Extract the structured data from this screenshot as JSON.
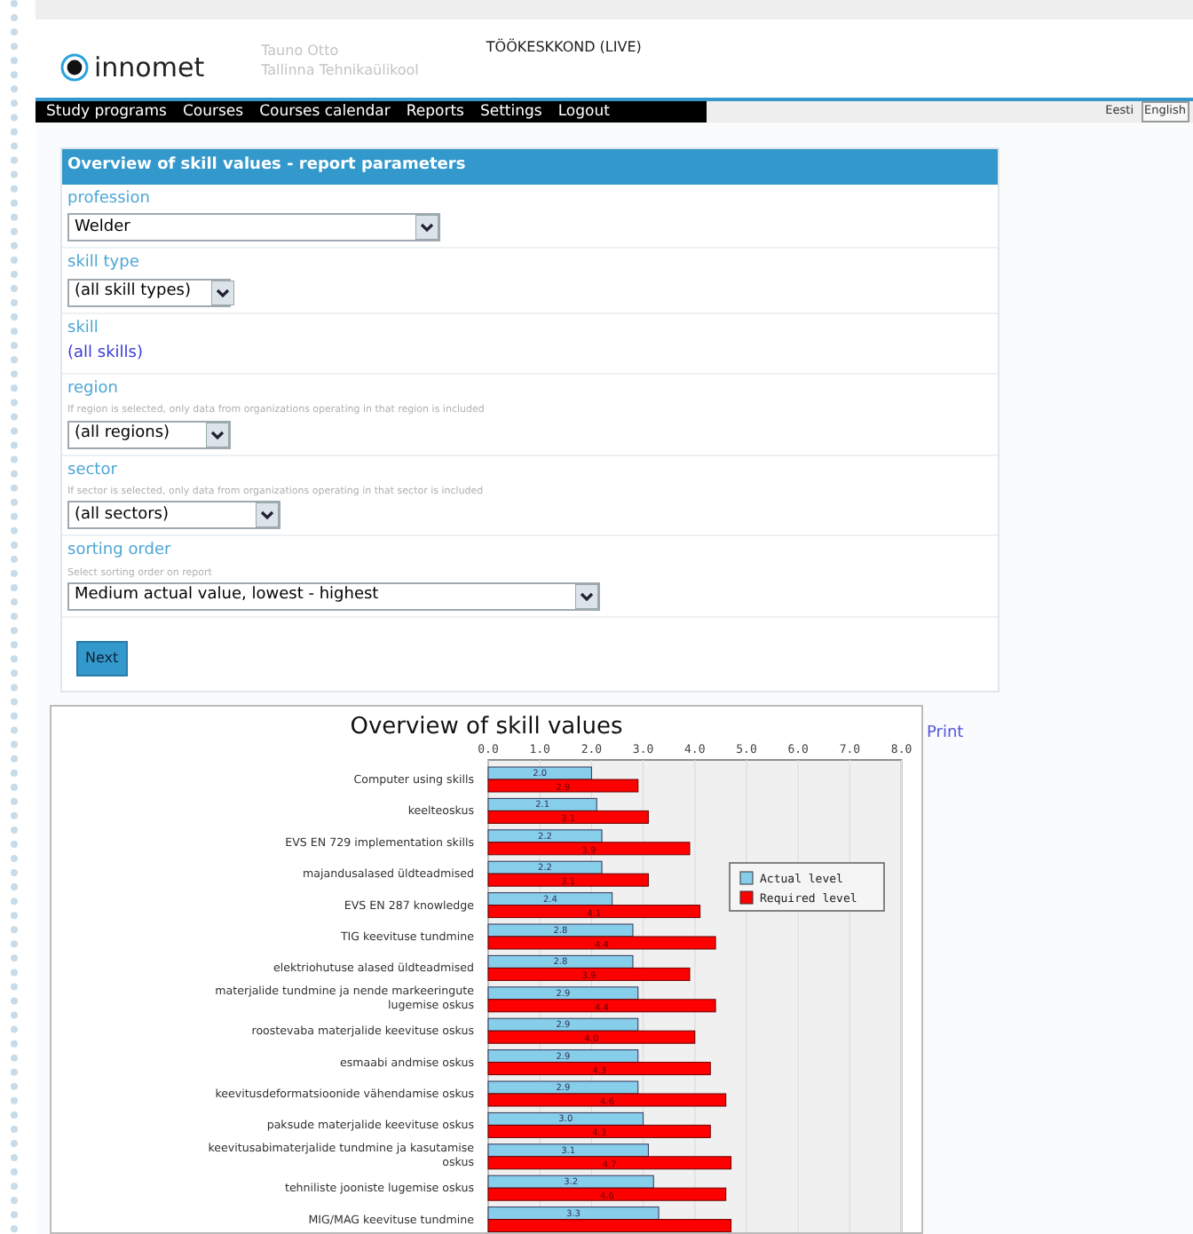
{
  "header": {
    "logo": "innomet",
    "user_name": "Tauno Otto",
    "organization": "Tallinna Tehnikaülikool",
    "environment": "TÖÖKESKKOND (LIVE)"
  },
  "nav": {
    "items": [
      "Study programs",
      "Courses",
      "Courses calendar",
      "Reports",
      "Settings",
      "Logout"
    ],
    "languages": [
      {
        "label": "Eesti",
        "selected": false
      },
      {
        "label": "English",
        "selected": true
      }
    ]
  },
  "form": {
    "title": "Overview of skill values - report parameters",
    "fields": [
      {
        "kind": "select",
        "label": "profession",
        "value": "Welder"
      },
      {
        "kind": "select",
        "label": "skill type",
        "value": "(all skill types)"
      },
      {
        "kind": "link",
        "label": "skill",
        "value": "(all skills)"
      },
      {
        "kind": "select",
        "label": "region",
        "hint": "If region is selected, only data from organizations operating in that region is included",
        "value": "(all regions)"
      },
      {
        "kind": "select",
        "label": "sector",
        "hint": "If sector is selected, only data from organizations operating in that sector is included",
        "value": "(all sectors)"
      },
      {
        "kind": "select",
        "label": "sorting order",
        "hint": "Select sorting order on report",
        "value": "Medium actual value, lowest - highest"
      }
    ],
    "button": "Next"
  },
  "report": {
    "print": "Print",
    "chart_data": {
      "type": "bar",
      "orientation": "horizontal",
      "title": "Overview of skill values",
      "grid": true,
      "legend": true,
      "value_labels": [
        [
          "2.0",
          "2.1",
          "2.2",
          "2.2",
          "2.4",
          "2.8",
          "2.8",
          "2.9",
          "2.9",
          "2.9",
          "2.9",
          "3.0",
          "3.1",
          "3.2",
          "3.3"
        ],
        [
          "2.9",
          "3.1",
          "3.9",
          "3.1",
          "4.1",
          "4.4",
          "3.9",
          "4.4",
          "4.0",
          "4.3",
          "4.6",
          "4.3",
          "4.7",
          "4.6",
          null
        ]
      ],
      "categories": [
        "Computer using skills",
        "keelteoskus",
        "EVS EN 729 implementation skills",
        "majandusalased üldteadmised",
        "EVS EN 287 knowledge",
        "TIG keevituse tundmine",
        "elektriohutuse alased üldteadmised",
        "materjalide tundmine ja nende markeeringute lugemise oskus",
        "roostevaba materjalide keevituse oskus",
        "esmaabi andmise oskus",
        "keevitusdeformatsioonide vähendamise oskus",
        "paksude materjalide keevituse oskus",
        "keevitusabimaterjalide tundmine ja kasutamise oskus",
        "tehniliste jooniste lugemise oskus",
        "MIG/MAG keevituse tundmine"
      ],
      "series": [
        {
          "name": "Actual level",
          "color": "#87ceeb",
          "values": [
            2.0,
            2.1,
            2.2,
            2.2,
            2.4,
            2.8,
            2.8,
            2.9,
            2.9,
            2.9,
            2.9,
            3.0,
            3.1,
            3.2,
            3.3
          ]
        },
        {
          "name": "Required level",
          "color": "#ff0000",
          "values": [
            2.9,
            3.1,
            3.9,
            3.1,
            4.1,
            4.4,
            3.9,
            4.4,
            4.0,
            4.3,
            4.6,
            4.3,
            4.7,
            4.6,
            4.7
          ]
        }
      ],
      "xlim": [
        0,
        8
      ],
      "xticks": [
        {
          "value": 0,
          "label": "0.0"
        },
        {
          "value": 1,
          "label": "1.0"
        },
        {
          "value": 2,
          "label": "2.0"
        },
        {
          "value": 3,
          "label": "3.0"
        },
        {
          "value": 4,
          "label": "4.0"
        },
        {
          "value": 5,
          "label": "5.0"
        },
        {
          "value": 6,
          "label": "6.0"
        },
        {
          "value": 7,
          "label": "7.0"
        },
        {
          "value": 8,
          "label": "8.0"
        }
      ]
    }
  }
}
